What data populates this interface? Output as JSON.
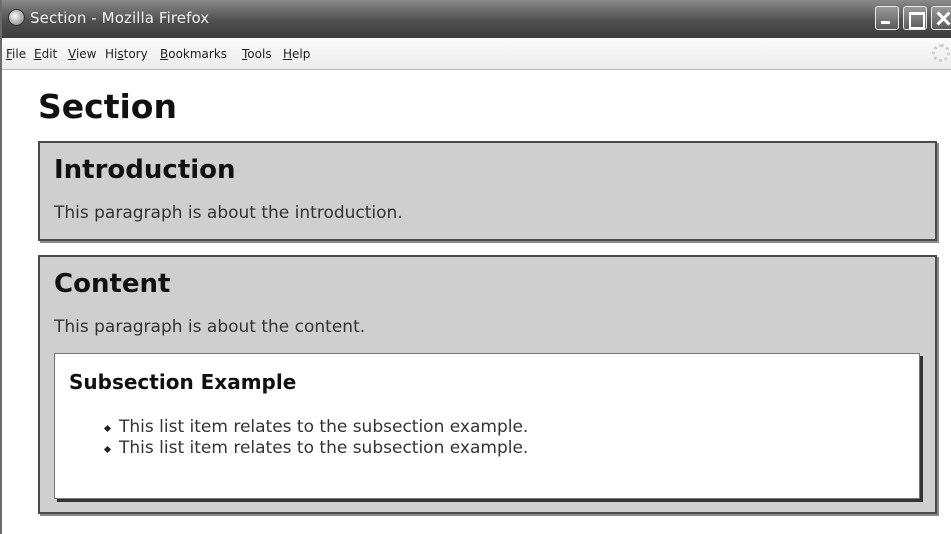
{
  "window": {
    "title": "Section - Mozilla Firefox"
  },
  "menubar": {
    "items": [
      {
        "key": "F",
        "rest": "ile"
      },
      {
        "key": "E",
        "rest": "dit"
      },
      {
        "key": "V",
        "rest": "iew"
      },
      {
        "key": "",
        "pre": "Hi",
        "keymid": "s",
        "rest": "tory"
      },
      {
        "key": "B",
        "rest": "ookmarks"
      },
      {
        "key": "T",
        "rest": "ools"
      },
      {
        "key": "H",
        "rest": "elp"
      }
    ]
  },
  "page": {
    "title": "Section",
    "introduction": {
      "heading": "Introduction",
      "paragraph": "This paragraph is about the introduction."
    },
    "content": {
      "heading": "Content",
      "paragraph": "This paragraph is about the content.",
      "subsection": {
        "heading": "Subsection Example",
        "items": [
          "This list item relates to the subsection example.",
          "This list item relates to the subsection example."
        ]
      }
    }
  }
}
